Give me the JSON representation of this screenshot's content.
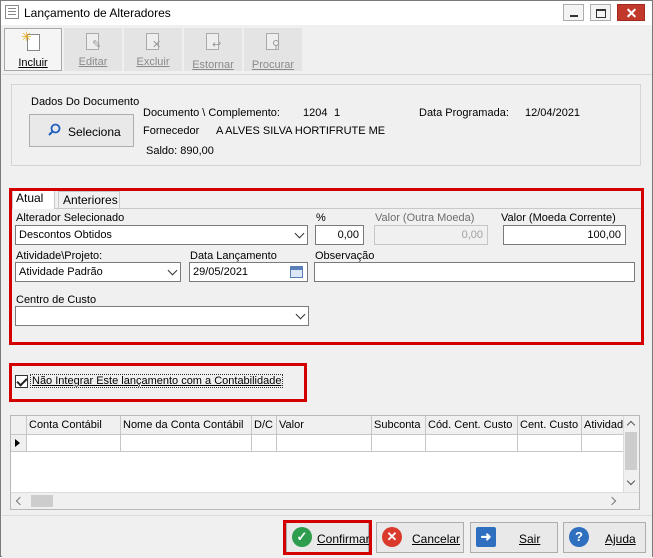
{
  "window": {
    "title": "Lançamento de Alteradores"
  },
  "toolbar": {
    "incluir": "Incluir",
    "editar": "Editar",
    "excluir": "Excluir",
    "estornar": "Estornar",
    "procurar": "Procurar"
  },
  "documento": {
    "section_title": "Dados Do Documento",
    "selecionar_button": "Seleciona",
    "doc_label": "Documento \\ Complemento:",
    "doc_num": "1204",
    "doc_compl": "1",
    "data_prog_label": "Data Programada:",
    "data_prog_value": "12/04/2021",
    "fornecedor_label": "Fornecedor",
    "fornecedor_value": "A ALVES SILVA HORTIFRUTE ME",
    "saldo": "Saldo: 890,00"
  },
  "tabs": {
    "atual": "Atual",
    "anteriores": "Anteriores"
  },
  "form": {
    "alterador_label": "Alterador Selecionado",
    "alterador_value": "Descontos Obtidos",
    "pct_label": "%",
    "pct_value": "0,00",
    "valor_outra_label": "Valor (Outra Moeda)",
    "valor_outra_value": "0,00",
    "valor_corrente_label": "Valor (Moeda Corrente)",
    "valor_corrente_value": "100,00",
    "atividade_label": "Atividade\\Projeto:",
    "atividade_value": "Atividade Padrão",
    "data_lanc_label": "Data Lançamento",
    "data_lanc_value": "29/05/2021",
    "observacao_label": "Observação",
    "observacao_value": "",
    "centro_label": "Centro de Custo",
    "centro_value": ""
  },
  "checkbox": {
    "label": "Não Integrar Este lançamento com a Contabilidade",
    "checked": true
  },
  "grid": {
    "columns": [
      "Conta Contábil",
      "Nome da Conta Contábil",
      "D/C",
      "Valor",
      "Subconta",
      "Cód. Cent. Custo",
      "Cent. Custo",
      "Atividad"
    ]
  },
  "buttons": {
    "confirmar": "Confirmar",
    "cancelar": "Cancelar",
    "sair": "Sair",
    "ajuda": "Ajuda"
  },
  "colors": {
    "highlight": "#d40000",
    "confirm": "#2e9e4e",
    "cancel": "#d93a2b",
    "help": "#2f6fc0"
  }
}
